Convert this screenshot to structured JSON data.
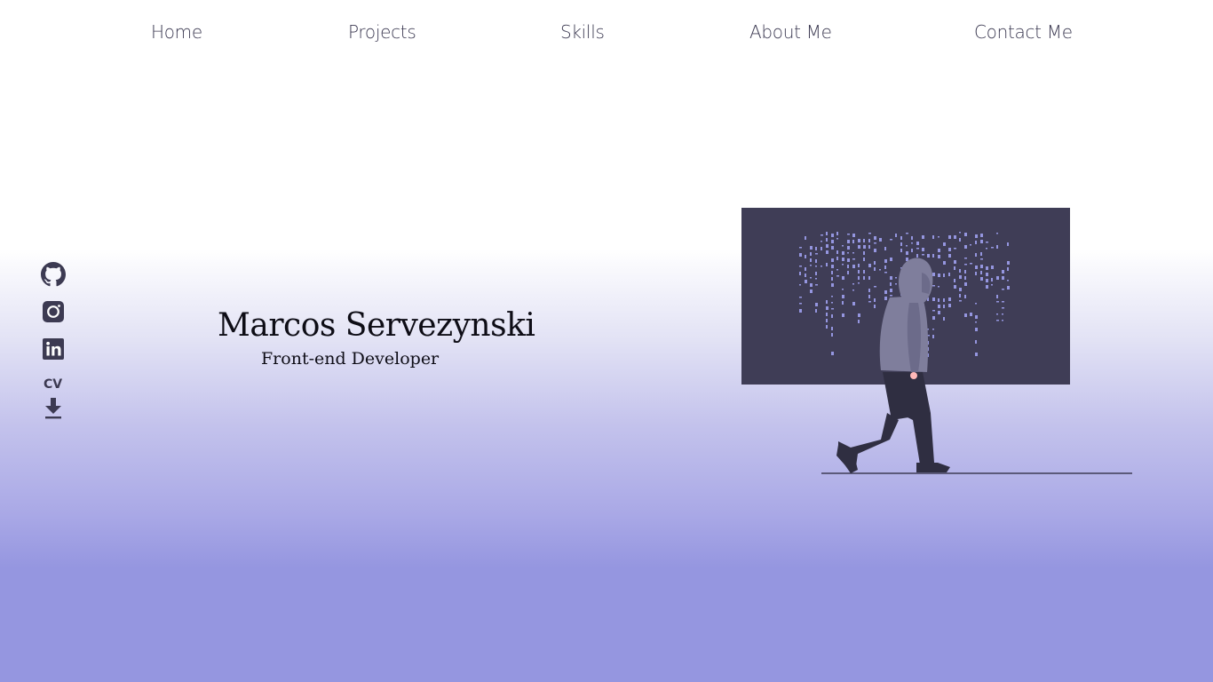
{
  "nav": {
    "items": [
      {
        "label": "Home"
      },
      {
        "label": "Projects"
      },
      {
        "label": "Skills"
      },
      {
        "label": "About Me"
      },
      {
        "label": "Contact Me"
      }
    ]
  },
  "socials": {
    "items": [
      {
        "icon": "github-icon"
      },
      {
        "icon": "instagram-icon"
      },
      {
        "icon": "linkedin-icon"
      }
    ],
    "cv_label": "CV",
    "cv_icon": "download-icon"
  },
  "hero": {
    "name": "Marcos Servezynski",
    "role": "Front-end Developer"
  },
  "colors": {
    "text": "#3c3a52",
    "panel": "#3f3d56",
    "accent": "#9596e0",
    "hoodie": "#7f7e9c"
  }
}
